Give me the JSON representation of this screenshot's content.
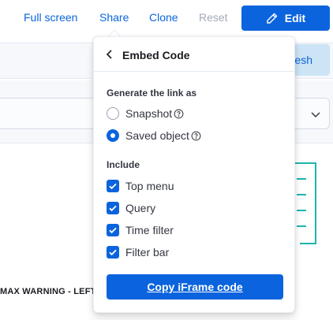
{
  "header": {
    "full_screen_label": "Full screen",
    "share_label": "Share",
    "clone_label": "Clone",
    "reset_label": "Reset",
    "edit_label": "Edit"
  },
  "background": {
    "refresh_label_fragment": "esh",
    "panel_title_fragment": "MAX WARNING - LEFT"
  },
  "embed_popover": {
    "title": "Embed Code",
    "generate_label": "Generate the link as",
    "link_options": [
      {
        "label": "Snapshot",
        "selected": false
      },
      {
        "label": "Saved object",
        "selected": true
      }
    ],
    "include_label": "Include",
    "include_options": [
      {
        "label": "Top menu",
        "checked": true
      },
      {
        "label": "Query",
        "checked": true
      },
      {
        "label": "Time filter",
        "checked": true
      },
      {
        "label": "Filter bar",
        "checked": true
      }
    ],
    "copy_button_label": "Copy iFrame code"
  },
  "colors": {
    "primary": "#0b64dd",
    "primary_light": "#cce4f5",
    "viz_accent": "#1fb5ad",
    "disabled_text": "#a2abba"
  },
  "icons": {
    "edit": "pencil-icon",
    "back": "chevron-left-icon",
    "help": "question-circle-icon",
    "select": "chevron-down-icon",
    "check": "check-icon"
  }
}
